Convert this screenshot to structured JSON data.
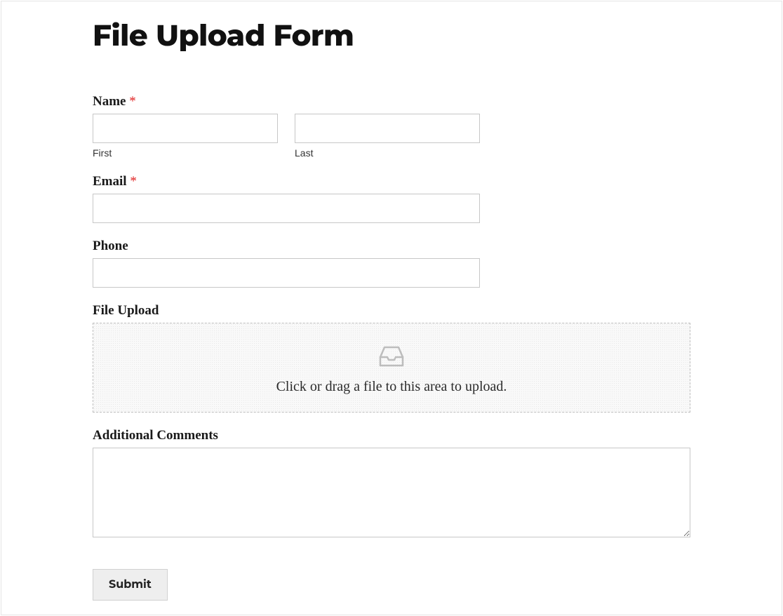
{
  "title": "File Upload Form",
  "fields": {
    "name": {
      "label": "Name",
      "required_marker": "*",
      "first_sublabel": "First",
      "last_sublabel": "Last",
      "first_value": "",
      "last_value": ""
    },
    "email": {
      "label": "Email",
      "required_marker": "*",
      "value": ""
    },
    "phone": {
      "label": "Phone",
      "value": ""
    },
    "file_upload": {
      "label": "File Upload",
      "drop_text": "Click or drag a file to this area to upload."
    },
    "comments": {
      "label": "Additional Comments",
      "value": ""
    }
  },
  "submit_label": "Submit"
}
